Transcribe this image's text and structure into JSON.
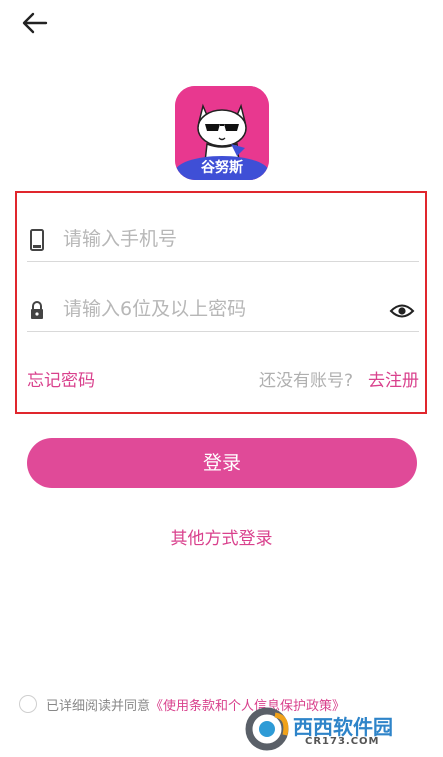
{
  "header": {
    "back_icon": "arrow-left-icon"
  },
  "app": {
    "logo_icon": "cat-with-sunglasses-logo",
    "logo_text": "谷努斯",
    "colors": {
      "accent": "#e04a98",
      "accent_text": "#d9418d",
      "logo_bg": "#e8388f",
      "logo_band": "#3f4fd6",
      "highlight_box": "#e0262d"
    }
  },
  "form": {
    "phone_placeholder": "请输入手机号",
    "phone_icon": "phone-icon",
    "password_placeholder": "请输入6位及以上密码",
    "password_icon": "lock-icon",
    "toggle_icon": "eye-icon",
    "forgot_label": "忘记密码",
    "no_account_label": "还没有账号?",
    "register_label": "去注册"
  },
  "actions": {
    "login_label": "登录",
    "other_login_label": "其他方式登录"
  },
  "agreement": {
    "prefix": "已详细阅读并同意",
    "policy_link": "《使用条款和个人信息保护政策》"
  },
  "watermark": {
    "brand": "西西软件园",
    "domain": "CR173.COM"
  }
}
